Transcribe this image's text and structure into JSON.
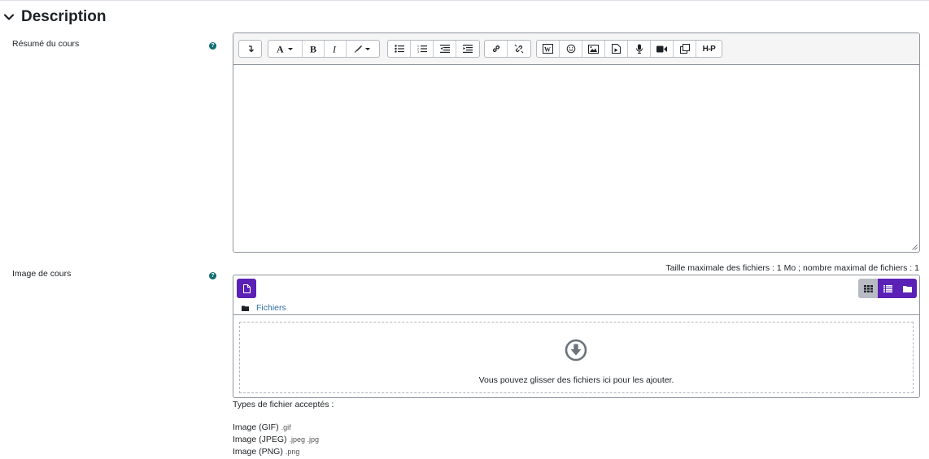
{
  "section": {
    "title": "Description",
    "icon": "chevron-down-icon"
  },
  "summary_field": {
    "label": "Résumé du cours",
    "help_icon": "question-circle-icon",
    "toolbar": {
      "groups": [
        [
          "collapse-toolbar-icon"
        ],
        [
          "font-style-icon",
          "bold-icon",
          "italic-icon",
          "font-color-icon"
        ],
        [
          "bullet-list-icon",
          "numbered-list-icon",
          "outdent-icon",
          "indent-icon"
        ],
        [
          "link-icon",
          "unlink-icon"
        ],
        [
          "equation-icon",
          "emoji-icon",
          "image-icon",
          "media-icon",
          "record-audio-icon",
          "record-video-icon",
          "manage-files-icon",
          "h5p-icon"
        ]
      ],
      "h5p_label": "H-P"
    },
    "content": ""
  },
  "image_field": {
    "label": "Image de cours",
    "help_icon": "question-circle-icon",
    "max_info": "Taille maximale des fichiers : 1 Mo ; nombre maximal de fichiers : 1",
    "path_label": "Fichiers",
    "drop_text": "Vous pouvez glisser des fichiers ici pour les ajouter.",
    "views": [
      "grid-view-icon",
      "list-view-icon",
      "tree-view-icon"
    ],
    "accent_color": "#5b21b6"
  },
  "accepted": {
    "title": "Types de fichier acceptés :",
    "types": [
      {
        "name": "Image (GIF)",
        "ext": ".gif"
      },
      {
        "name": "Image (JPEG)",
        "ext": ".jpeg .jpg"
      },
      {
        "name": "Image (PNG)",
        "ext": ".png"
      }
    ]
  }
}
